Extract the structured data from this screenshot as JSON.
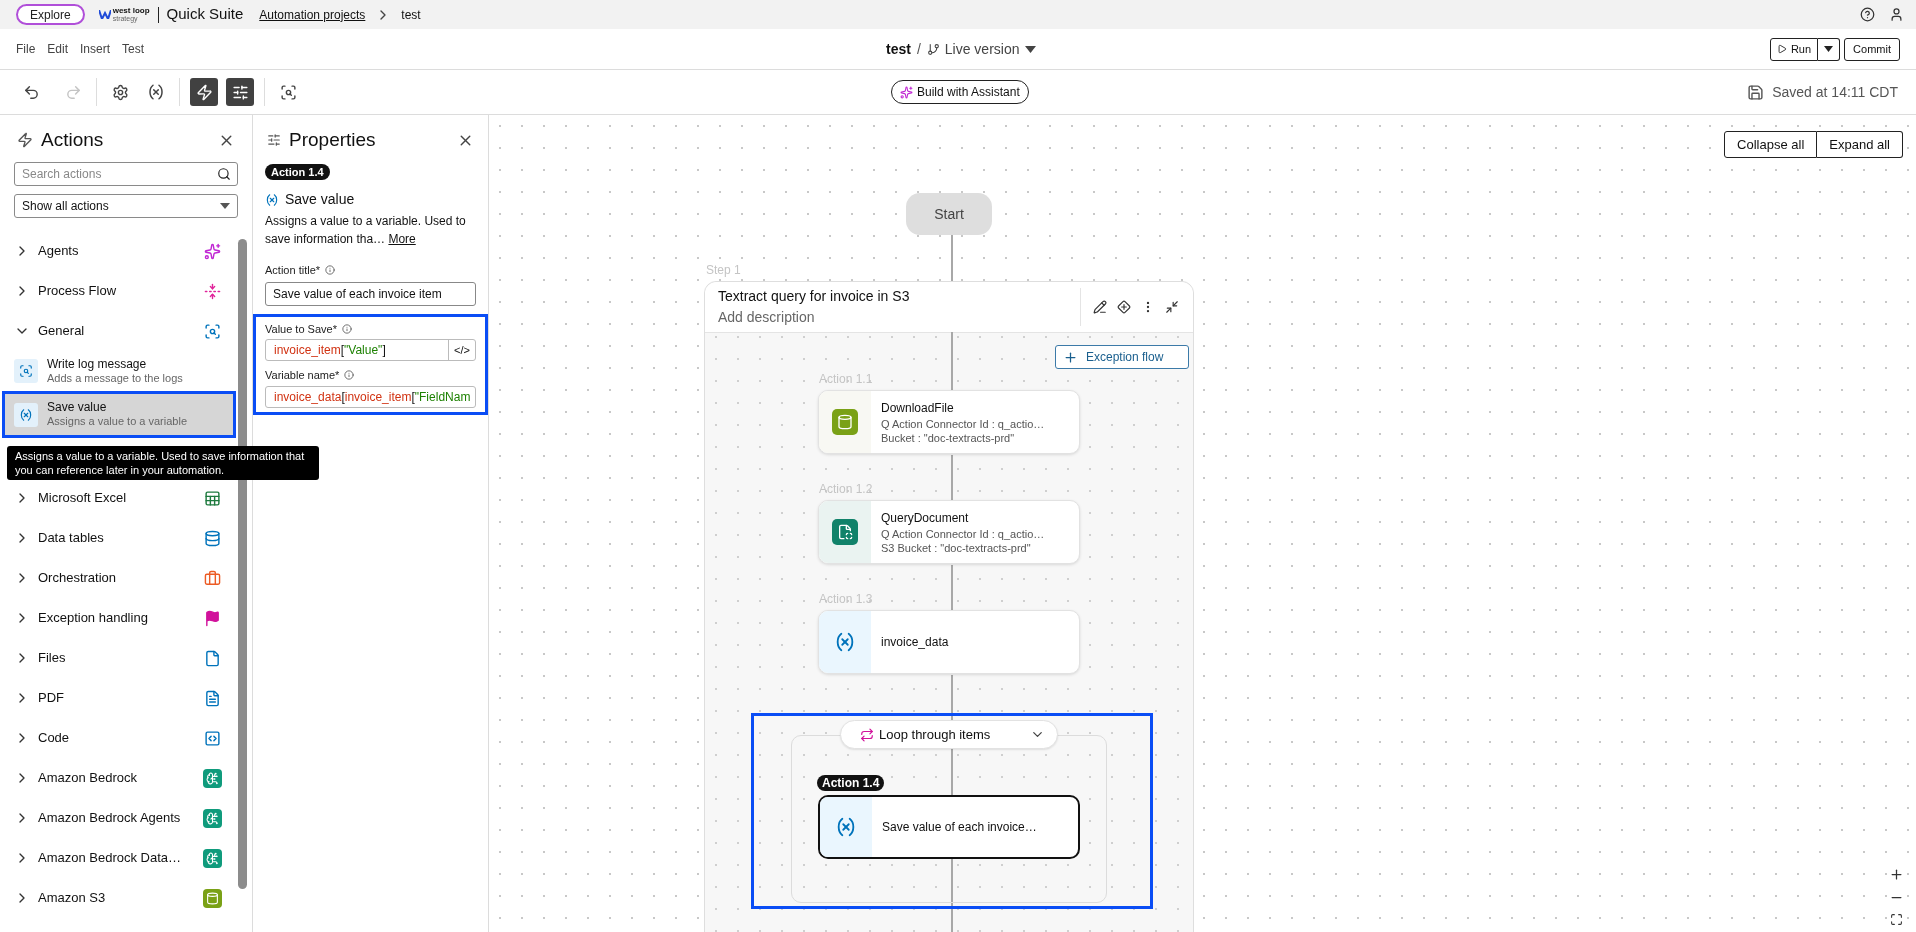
{
  "top_bar": {
    "explore_button": "Explore",
    "logo": {
      "name": "west loop",
      "tagline": "strategy"
    },
    "app_name": "Quick Suite",
    "breadcrumbs": [
      {
        "label": "Automation projects",
        "kind": "link"
      },
      {
        "label": "test",
        "kind": "current"
      }
    ]
  },
  "menu_bar": {
    "menus": [
      "File",
      "Edit",
      "Insert",
      "Test"
    ],
    "project": "test",
    "separator": "/",
    "version": "Live version",
    "run_button": "Run",
    "commit_button": "Commit"
  },
  "toolbar": {
    "history": [
      {
        "kind": "undo",
        "disabled": false
      },
      {
        "kind": "redo",
        "disabled": true
      }
    ],
    "panel_toggles": [
      {
        "kind": "actions",
        "selected": true
      },
      {
        "kind": "properties",
        "selected": true
      }
    ],
    "assistant_button": "Build with Assistant",
    "save_status": "Saved at 14:11 CDT"
  },
  "actions_panel": {
    "title": "Actions",
    "search": {
      "placeholder": "Search actions"
    },
    "filter": "Show all actions",
    "categories": [
      {
        "label": "Agents",
        "expanded": false
      },
      {
        "label": "Process Flow",
        "expanded": false
      },
      {
        "label": "General",
        "expanded": true,
        "children": [
          {
            "title": "Write log message",
            "subtitle": "Adds a message to the logs",
            "selected": false,
            "highlighted": false
          },
          {
            "title": "Save value",
            "subtitle": "Assigns a value to a variable",
            "selected": true,
            "highlighted": true
          }
        ]
      },
      {
        "label": "Microsoft Excel",
        "expanded": false
      },
      {
        "label": "Data tables",
        "expanded": false
      },
      {
        "label": "Orchestration",
        "expanded": false
      },
      {
        "label": "Exception handling",
        "expanded": false
      },
      {
        "label": "Files",
        "expanded": false
      },
      {
        "label": "PDF",
        "expanded": false
      },
      {
        "label": "Code",
        "expanded": false
      },
      {
        "label": "Amazon Bedrock",
        "expanded": false
      },
      {
        "label": "Amazon Bedrock Agents",
        "expanded": false
      },
      {
        "label": "Amazon Bedrock Data…",
        "expanded": false
      },
      {
        "label": "Amazon S3",
        "expanded": false
      }
    ],
    "tooltip": "Assigns a value to a variable. Used to save information that you can reference later in your automation."
  },
  "properties_panel": {
    "title": "Properties",
    "badge": "Action 1.4",
    "action_name": "Save value",
    "description": "Assigns a value to a variable. Used to save information tha…",
    "more_link": "More",
    "title_field": {
      "label": "Action title*",
      "value": "Save value of each invoice item"
    },
    "expression_group": {
      "highlighted": true,
      "fields": [
        {
          "label": "Value to Save*",
          "code_button": "</>",
          "tokens": [
            {
              "text": "invoice_item",
              "kind": "variable"
            },
            {
              "text": "[",
              "kind": "punct"
            },
            {
              "text": "\"Value\"",
              "kind": "string"
            },
            {
              "text": "]",
              "kind": "punct"
            }
          ]
        },
        {
          "label": "Variable name*",
          "tokens": [
            {
              "text": "invoice_data",
              "kind": "variable"
            },
            {
              "text": "[",
              "kind": "punct"
            },
            {
              "text": "invoice_item",
              "kind": "variable"
            },
            {
              "text": "[",
              "kind": "punct"
            },
            {
              "text": "\"FieldNam",
              "kind": "string"
            }
          ]
        }
      ]
    }
  },
  "canvas": {
    "collapse_button": "Collapse all",
    "expand_button": "Expand all",
    "start": "Start",
    "step": {
      "label": "Step 1",
      "title": "Textract query for invoice in S3",
      "description": "Add description",
      "exception_button": "Exception flow",
      "actions": [
        {
          "badge": "Action 1.1",
          "kind": "s3",
          "title": "DownloadFile",
          "lines": [
            "Q Action Connector Id : q_actio…",
            "Bucket : \"doc-textracts-prd\""
          ],
          "selected": false
        },
        {
          "badge": "Action 1.2",
          "kind": "textract",
          "title": "QueryDocument",
          "lines": [
            "Q Action Connector Id : q_actio…",
            "S3 Bucket : \"doc-textracts-prd\""
          ],
          "selected": false
        },
        {
          "badge": "Action 1.3",
          "kind": "variable",
          "title": "invoice_data",
          "selected": false
        }
      ],
      "loop": {
        "label": "Loop through items",
        "highlighted": true,
        "actions": [
          {
            "badge": "Action 1.4",
            "kind": "variable",
            "title": "Save value of each invoice…",
            "selected": true
          }
        ]
      }
    }
  }
}
